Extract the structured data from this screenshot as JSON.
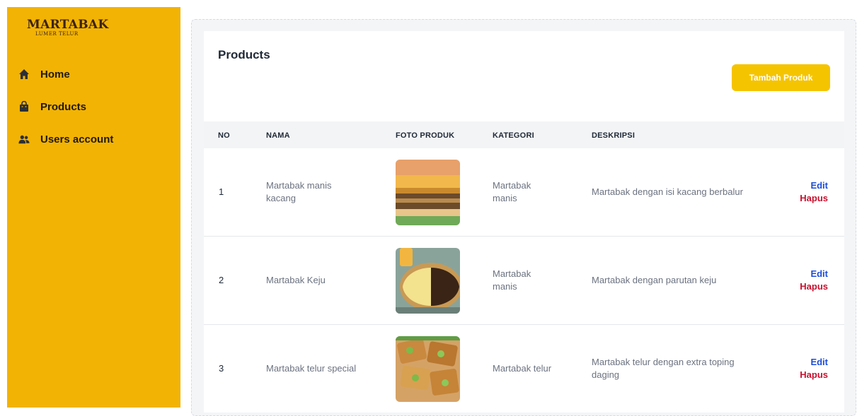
{
  "brand": {
    "title": "MARTABAK",
    "subtitle": "LUMER TELUR"
  },
  "sidebar": {
    "items": [
      {
        "label": "Home",
        "icon": "home-icon"
      },
      {
        "label": "Products",
        "icon": "bag-icon"
      },
      {
        "label": "Users account",
        "icon": "users-icon"
      }
    ]
  },
  "page": {
    "title": "Products",
    "add_button": "Tambah Produk"
  },
  "table": {
    "headers": {
      "no": "NO",
      "nama": "NAMA",
      "foto": "FOTO PRODUK",
      "kategori": "KATEGORI",
      "deskripsi": "DESKRIPSI"
    },
    "rows": [
      {
        "no": "1",
        "nama": "Martabak manis kacang",
        "kategori": "Martabak manis",
        "deskripsi": "Martabak dengan isi kacang berbalur",
        "edit": "Edit",
        "delete": "Hapus"
      },
      {
        "no": "2",
        "nama": "Martabak Keju",
        "kategori": "Martabak manis",
        "deskripsi": "Martabak dengan parutan keju",
        "edit": "Edit",
        "delete": "Hapus"
      },
      {
        "no": "3",
        "nama": "Martabak telur special",
        "kategori": "Martabak telur",
        "deskripsi": "Martabak telur dengan extra toping daging",
        "edit": "Edit",
        "delete": "Hapus"
      }
    ]
  },
  "colors": {
    "sidebar": "#f2b304",
    "accent_button": "#f5c400",
    "edit_link": "#1d4ed8",
    "delete_link": "#c8102e"
  }
}
